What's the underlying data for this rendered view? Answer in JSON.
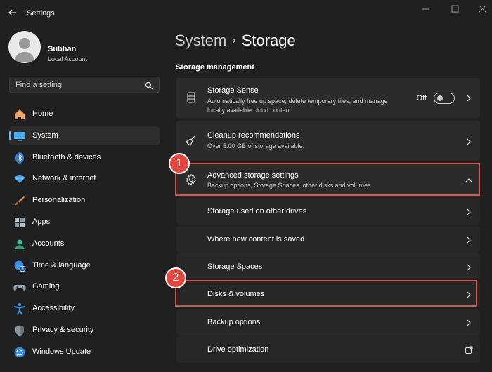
{
  "window": {
    "title": "Settings"
  },
  "profile": {
    "name": "Subhan",
    "account_type": "Local Account"
  },
  "search": {
    "placeholder": "Find a setting"
  },
  "nav": [
    {
      "label": "Home",
      "icon": "home-icon"
    },
    {
      "label": "System",
      "icon": "system-icon",
      "selected": true
    },
    {
      "label": "Bluetooth & devices",
      "icon": "bluetooth-icon"
    },
    {
      "label": "Network & internet",
      "icon": "network-icon"
    },
    {
      "label": "Personalization",
      "icon": "brush-icon"
    },
    {
      "label": "Apps",
      "icon": "apps-icon"
    },
    {
      "label": "Accounts",
      "icon": "accounts-icon"
    },
    {
      "label": "Time & language",
      "icon": "globe-clock-icon"
    },
    {
      "label": "Gaming",
      "icon": "gamepad-icon"
    },
    {
      "label": "Accessibility",
      "icon": "accessibility-icon"
    },
    {
      "label": "Privacy & security",
      "icon": "shield-icon"
    },
    {
      "label": "Windows Update",
      "icon": "update-icon"
    }
  ],
  "breadcrumb": {
    "parent": "System",
    "separator": "›",
    "current": "Storage"
  },
  "section_title": "Storage management",
  "cards": {
    "storage_sense": {
      "title": "Storage Sense",
      "description": "Automatically free up space, delete temporary files, and manage locally available cloud content",
      "toggle_label": "Off",
      "toggle_on": false
    },
    "cleanup": {
      "title": "Cleanup recommendations",
      "description": "Over 5.00 GB of storage available."
    },
    "advanced": {
      "title": "Advanced storage settings",
      "description": "Backup options, Storage Spaces, other disks and volumes",
      "expanded": true
    },
    "sub_items": [
      {
        "label": "Storage used on other drives"
      },
      {
        "label": "Where new content is saved"
      },
      {
        "label": "Storage Spaces"
      },
      {
        "label": "Disks & volumes"
      },
      {
        "label": "Backup options"
      },
      {
        "label": "Drive optimization",
        "external": true
      }
    ]
  },
  "annotations": {
    "step1": "1",
    "step2": "2",
    "color": "#d9534f"
  },
  "colors": {
    "accent": "#4cc2ff",
    "background": "#202020",
    "card": "#2b2b2b"
  }
}
